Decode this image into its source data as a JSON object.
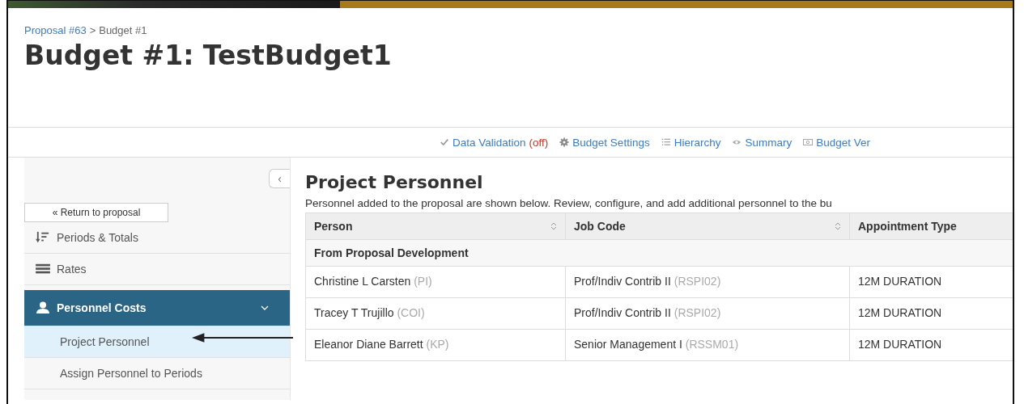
{
  "breadcrumb": [
    {
      "label": "Proposal #63",
      "link": true
    },
    {
      "label": ">",
      "link": false
    },
    {
      "label": "Budget #1",
      "link": false
    }
  ],
  "title": "Budget #1: TestBudget1",
  "toolbar": [
    {
      "kind": "check",
      "label": "Data Validation",
      "status": "(off)"
    },
    {
      "kind": "gear",
      "label": "Budget Settings"
    },
    {
      "kind": "list",
      "label": "Hierarchy"
    },
    {
      "kind": "eye",
      "label": "Summary"
    },
    {
      "kind": "money",
      "label": "Budget Ver"
    }
  ],
  "sidebar": {
    "return_button": "« Return to proposal",
    "collapse_button": "‹",
    "items": [
      {
        "kind": "sort",
        "label": "Periods & Totals",
        "selected": false
      },
      {
        "kind": "rates",
        "label": "Rates",
        "selected": false
      },
      {
        "kind": "person",
        "label": "Personnel Costs",
        "selected": true,
        "expanded": true,
        "children": [
          {
            "label": "Project Personnel",
            "selected": true
          },
          {
            "label": "Assign Personnel to Periods",
            "selected": false
          }
        ]
      }
    ]
  },
  "main": {
    "heading": "Project Personnel",
    "description": "Personnel added to the proposal are shown below. Review, configure, and add additional personnel to the bu",
    "table": {
      "columns": [
        {
          "label": "Person",
          "sortable": true
        },
        {
          "label": "Job Code",
          "sortable": true
        },
        {
          "label": "Appointment Type"
        }
      ],
      "group": "From Proposal Development",
      "rows": [
        {
          "person": "Christine L Carsten",
          "role": "(PI)",
          "job": "Prof/Indiv Contrib II",
          "job_code": "(RSPI02)",
          "appointment": "12M DURATION"
        },
        {
          "person": "Tracey T Trujillo",
          "role": "(COI)",
          "job": "Prof/Indiv Contrib II",
          "job_code": "(RSPI02)",
          "appointment": "12M DURATION"
        },
        {
          "person": "Eleanor Diane Barrett",
          "role": "(KP)",
          "job": "Senior Management I",
          "job_code": "(RSSM01)",
          "appointment": "12M DURATION"
        }
      ]
    }
  }
}
